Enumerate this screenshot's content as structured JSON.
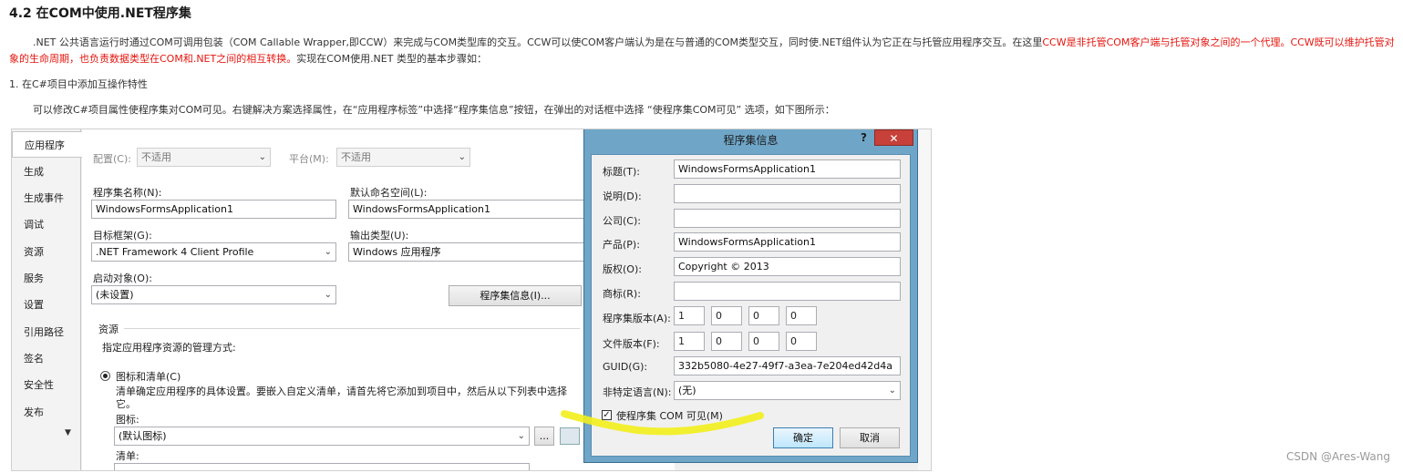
{
  "heading": "4.2 在COM中使用.NET程序集",
  "paragraph": {
    "part1": ".NET 公共语言运行时通过COM可调用包装（COM Callable Wrapper,即CCW）来完成与COM类型库的交互。CCW可以使COM客户端认为是在与普通的COM类型交互，同时使.NET组件认为它正在与托管应用程序交互。在这里",
    "red": "CCW是非托管COM客户端与托管对象之间的一个代理。CCW既可以维护托管对象的生命周期，也负责数据类型在COM和.NET之间的相互转换。",
    "part2": "实现在COM使用.NET 类型的基本步骤如："
  },
  "step1": "1. 在C#项目中添加互操作特性",
  "step1_desc": "可以修改C#项目属性使程序集对COM可见。右键解决方案选择属性，在“应用程序标签”中选择“程序集信息”按钮，在弹出的对话框中选择 “使程序集COM可见” 选项，如下图所示：",
  "project_props": {
    "tabs": [
      "应用程序",
      "生成",
      "生成事件",
      "调试",
      "资源",
      "服务",
      "设置",
      "引用路径",
      "签名",
      "安全性",
      "发布"
    ],
    "config_label": "配置(C):",
    "config_value": "不适用",
    "platform_label": "平台(M):",
    "platform_value": "不适用",
    "assembly_name_label": "程序集名称(N):",
    "assembly_name_value": "WindowsFormsApplication1",
    "default_ns_label": "默认命名空间(L):",
    "default_ns_value": "WindowsFormsApplication1",
    "target_fw_label": "目标框架(G):",
    "target_fw_value": ".NET Framework 4 Client Profile",
    "output_type_label": "输出类型(U):",
    "output_type_value": "Windows 应用程序",
    "startup_label": "启动对象(O):",
    "startup_value": "(未设置)",
    "assembly_info_button": "程序集信息(I)...",
    "resources_section": "资源",
    "resources_desc": "指定应用程序资源的管理方式:",
    "radio_label": "图标和清单(C)",
    "manifest_desc_line1": "清单确定应用程序的具体设置。要嵌入自定义清单，请首先将它添加到项目中，然后从以下列表中选择",
    "manifest_desc_line2": "它。",
    "icon_label": "图标:",
    "icon_value": "(默认图标)",
    "browse_button": "...",
    "manifest_label": "清单:"
  },
  "dialog": {
    "title": "程序集信息",
    "help": "?",
    "close": "✕",
    "title_label": "标题(T):",
    "title_value": "WindowsFormsApplication1",
    "desc_label": "说明(D):",
    "desc_value": "",
    "company_label": "公司(C):",
    "company_value": "",
    "product_label": "产品(P):",
    "product_value": "WindowsFormsApplication1",
    "copyright_label": "版权(O):",
    "copyright_value": "Copyright ©  2013",
    "trademark_label": "商标(R):",
    "trademark_value": "",
    "assembly_version_label": "程序集版本(A):",
    "assembly_version": [
      "1",
      "0",
      "0",
      "0"
    ],
    "file_version_label": "文件版本(F):",
    "file_version": [
      "1",
      "0",
      "0",
      "0"
    ],
    "guid_label": "GUID(G):",
    "guid_value": "332b5080-4e27-49f7-a3ea-7e204ed42d4a",
    "neutral_lang_label": "非特定语言(N):",
    "neutral_lang_value": "(无)",
    "com_visible_label": "使程序集 COM 可见(M)",
    "com_visible_checked": "✓",
    "ok_button": "确定",
    "cancel_button": "取消"
  },
  "highlight_color": "#f2ee1c",
  "watermark": "CSDN @Ares-Wang"
}
